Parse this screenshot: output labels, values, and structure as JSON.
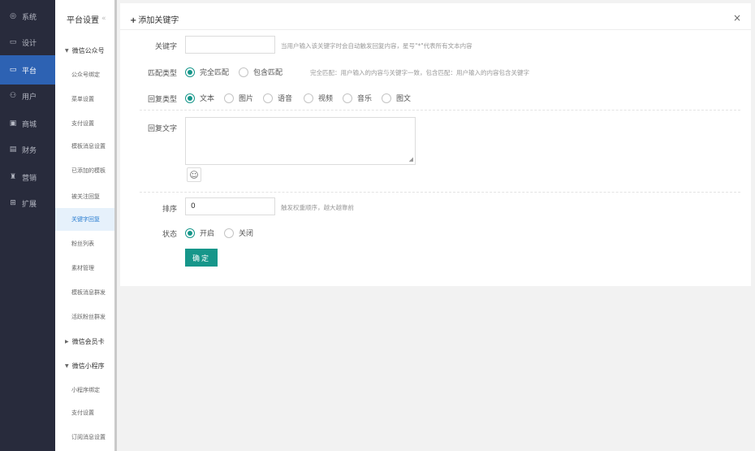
{
  "nav": {
    "items": [
      {
        "icon": "gear-icon",
        "glyph": "◎",
        "label": "系统"
      },
      {
        "icon": "monitor-icon",
        "glyph": "▭",
        "label": "设计"
      },
      {
        "icon": "monitor-icon",
        "glyph": "▭",
        "label": "平台"
      },
      {
        "icon": "users-icon",
        "glyph": "⚇",
        "label": "用户"
      },
      {
        "icon": "shop-icon",
        "glyph": "▣",
        "label": "商城"
      },
      {
        "icon": "finance-icon",
        "glyph": "▤",
        "label": "财务"
      },
      {
        "icon": "marketing-icon",
        "glyph": "♜",
        "label": "营销"
      },
      {
        "icon": "extend-icon",
        "glyph": "⊞",
        "label": "扩展"
      }
    ],
    "active_index": 2
  },
  "sub": {
    "title": "平台设置",
    "collapse_glyph": "«",
    "groups": {
      "wechat_official": "微信公众号",
      "wechat_card": "微信会员卡",
      "mini_program": "微信小程序"
    },
    "official_items": [
      "公众号绑定",
      "菜单设置",
      "支付设置",
      "模板消息设置",
      "已添加的模板",
      "被关注回复",
      "关键字回复",
      "粉丝列表",
      "素材管理",
      "模板消息群发",
      "活跃粉丝群发"
    ],
    "mini_items": [
      "小程序绑定",
      "支付设置",
      "订阅消息设置"
    ],
    "active_item": "关键字回复"
  },
  "form": {
    "title": "添加关键字",
    "plus": "+",
    "close": "×",
    "keyword": {
      "label": "关键字",
      "value": "",
      "hint": "当用户输入该关键字时会自动触发回复内容，星号\"*\"代表所有文本内容"
    },
    "match": {
      "label": "匹配类型",
      "options": [
        "完全匹配",
        "包含匹配"
      ],
      "selected": 0,
      "hint": "完全匹配：用户输入的内容与关键字一致，包含匹配：用户输入的内容包含关键字"
    },
    "reply_type": {
      "label": "回复类型",
      "options": [
        "文本",
        "图片",
        "语音",
        "视频",
        "音乐",
        "图文"
      ],
      "selected": 0
    },
    "reply_text": {
      "label": "回复文字",
      "value": ""
    },
    "sort": {
      "label": "排序",
      "value": "0",
      "hint": "触发权重顺序，越大越靠前"
    },
    "status": {
      "label": "状态",
      "options": [
        "开启",
        "关闭"
      ],
      "selected": 0
    },
    "submit_label": "确定"
  },
  "colors": {
    "sidebar_bg": "#282b3c",
    "active_nav": "#2d62b3",
    "accent": "#16968a"
  }
}
